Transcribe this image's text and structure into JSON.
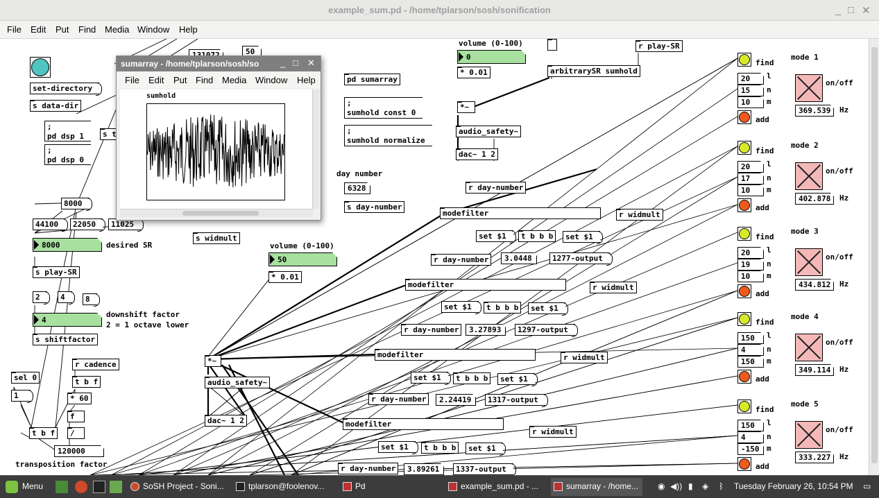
{
  "window": {
    "title": "example_sum.pd - /home/tplarson/sosh/sonification",
    "controls": {
      "minimize": "_",
      "maximize": "□",
      "close": "✕"
    }
  },
  "menubar": [
    "File",
    "Edit",
    "Put",
    "Find",
    "Media",
    "Window",
    "Help"
  ],
  "popup": {
    "title": "sumarray - /home/tplarson/sosh/so",
    "menu": [
      "File",
      "Edit",
      "Put",
      "Find",
      "Media",
      "Window",
      "Help"
    ],
    "array_label": "sumhold"
  },
  "left": {
    "set_directory": "set-directory",
    "s_data_dir": "s data-dir",
    "pd_dsp_1": ";\npd dsp 1",
    "pd_dsp_0": ";\npd dsp 0",
    "sr_8000_msg": "8000",
    "sr_44100": "44100",
    "sr_22050": "22050",
    "sr_11025": "11025",
    "sr_number": "8000",
    "desired_sr": "desired SR",
    "s_play_sr": "s play-SR",
    "shift_2": "2",
    "shift_4": "4",
    "shift_8": "8",
    "shift_number": "4",
    "downshift_label_1": "downshift factor",
    "downshift_label_2": "2 = 1 octave lower",
    "s_shiftfactor": "s shiftfactor",
    "r_cadence": "r cadence",
    "sel_0": "sel 0",
    "msg_1": "1",
    "tbf_1": "t b f",
    "mul_60": "* 60",
    "f_obj": "f",
    "div_obj": "/",
    "tbf_2": "t b f",
    "num_120000": "120000",
    "transposition": "transposition factor",
    "partial_131072": "131072",
    "partial_50": "50",
    "partial_s_ti": "s ti",
    "s_widmult": "s widmult"
  },
  "center": {
    "pd_sumarray": "pd sumarray",
    "sumhold_const": ";\nsumhold const 0",
    "sumhold_normalize": ";\nsumhold normalize",
    "day_number_label": "day number",
    "day_number_value": "6328",
    "s_day_number": "s day-number",
    "volume_label_top": "volume (0-100)",
    "volume_top_value": "0",
    "mul_001_top": "* 0.01",
    "mul_tilde_top": "*~",
    "audio_safety_top": "audio_safety~",
    "dac_top": "dac~ 1 2",
    "arbitrary_sr": "arbitrarySR sumhold",
    "r_play_sr": "r play-SR",
    "volume_label_mid": "volume (0-100)",
    "volume_mid_value": "50",
    "mul_001_mid": "* 0.01",
    "mul_tilde_mid": "*~",
    "audio_safety_mid": "audio_safety~",
    "dac_mid": "dac~ 1 2"
  },
  "filters": [
    {
      "r_day": "r day-number",
      "modefilter": "modefilter",
      "r_widmult": "r widmult",
      "set": "set $1",
      "tbbb": "t b b b",
      "set2": "set $1",
      "value": "3.0448",
      "output": "1277-output"
    },
    {
      "r_day": "r day-number",
      "modefilter": "modefilter",
      "r_widmult": "r widmult",
      "set": "set $1",
      "tbbb": "t b b b",
      "set2": "set $1",
      "value": "3.27893",
      "output": "1297-output"
    },
    {
      "r_day": "r day-number",
      "modefilter": "modefilter",
      "r_widmult": "r widmult",
      "set": "set $1",
      "tbbb": "t b b b",
      "set2": "set $1",
      "value": "2.24419",
      "output": "1317-output"
    },
    {
      "r_day": "r day-number",
      "modefilter": "modefilter",
      "r_widmult": "r widmult",
      "set": "set $1",
      "tbbb": "t b b b",
      "set2": "set $1",
      "value": "3.89261",
      "output": "1337-output"
    }
  ],
  "modes": [
    {
      "title": "mode 1",
      "l": "20",
      "n": "15",
      "m": "10",
      "hz": "369.539"
    },
    {
      "title": "mode 2",
      "l": "20",
      "n": "17",
      "m": "10",
      "hz": "402.878"
    },
    {
      "title": "mode 3",
      "l": "20",
      "n": "19",
      "m": "10",
      "hz": "434.812"
    },
    {
      "title": "mode 4",
      "l": "150",
      "n": "4",
      "m": "150",
      "hz": "349.114"
    },
    {
      "title": "mode 5",
      "l": "150",
      "n": "4",
      "m": "-150",
      "hz": "333.227"
    }
  ],
  "mode_labels": {
    "find": "find",
    "add": "add",
    "l": "l",
    "n": "n",
    "m": "m",
    "onoff": "on/off",
    "hz": "Hz"
  },
  "colors": {
    "bang_find": "#d6ea2a",
    "bang_add": "#ee5a1e",
    "toggle": "#f4b8b8",
    "number_green": "#a8e0a0",
    "teal_bang": "#4fc4c0"
  },
  "taskbar": {
    "menu": "Menu",
    "tasks": [
      {
        "label": "SoSH Project - Soni...",
        "icon": "browser-icon"
      },
      {
        "label": "tplarson@foolenov...",
        "icon": "terminal-icon"
      },
      {
        "label": "Pd",
        "icon": "pd-icon"
      },
      {
        "label": "example_sum.pd - ...",
        "icon": "pd-icon"
      },
      {
        "label": "sumarray - /home...",
        "icon": "pd-icon"
      }
    ],
    "clock": "Tuesday February 26, 10:54 PM"
  }
}
